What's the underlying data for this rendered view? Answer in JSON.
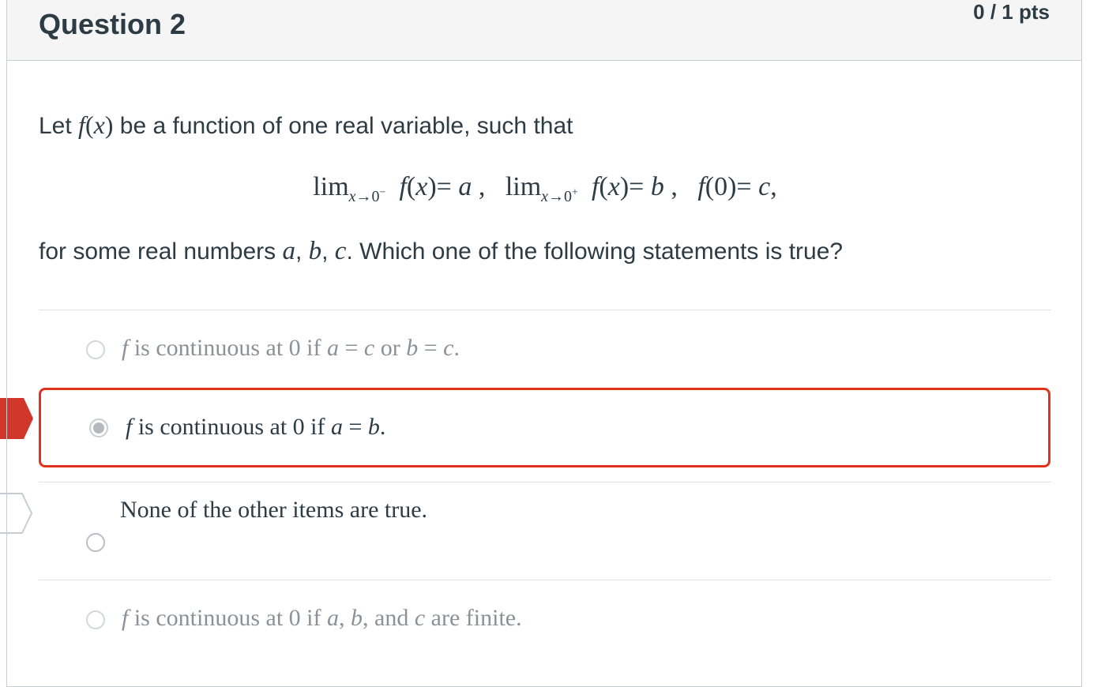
{
  "question": {
    "title": "Question 2",
    "points": "0 / 1 pts",
    "stem_intro": "Let f(x) be a function of one real variable, such that",
    "stem_limits": "lim x→0⁻ f(x)= a ,  lim x→0⁺ f(x)= b ,  f(0)= c,",
    "stem_question": "for some real numbers a, b, c. Which one of the following statements is true?"
  },
  "answers": [
    {
      "label": "f is continuous at 0 if a = c or b = c.",
      "selected": false,
      "state": "incorrect-dimmed"
    },
    {
      "label": "f is continuous at 0 if a = b.",
      "selected": true,
      "state": "your-answer-wrong"
    },
    {
      "label": "None of the other items are true.",
      "selected": false,
      "state": "correct-answer"
    },
    {
      "label": "f is continuous at 0 if a, b, and c are finite.",
      "selected": false,
      "state": "incorrect-dimmed"
    }
  ],
  "colors": {
    "wrong_border": "#e0321d",
    "header_bg": "#f5f5f5",
    "text": "#2d3b45",
    "dim_text": "#8a9297"
  }
}
